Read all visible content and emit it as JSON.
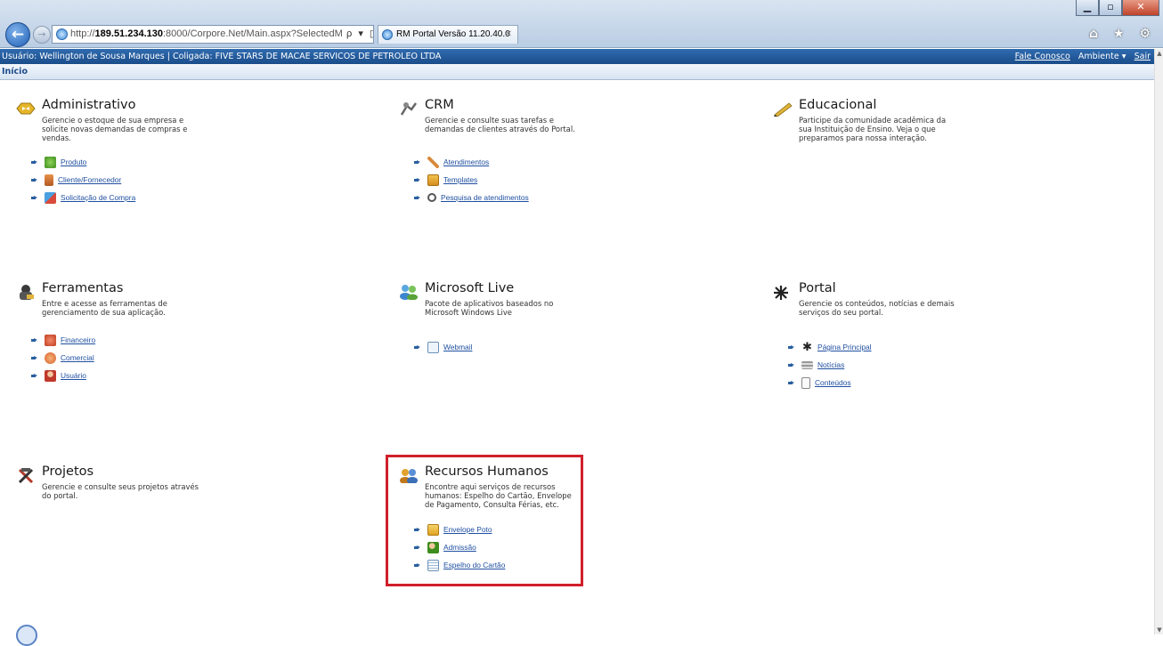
{
  "browser": {
    "url_prefix": "http://",
    "url_host": "189.51.234.130",
    "url_rest": ":8000/Corpore.Net/Main.aspx?SelectedM",
    "address_controls": "ρ ▾ ▯ ↻ ✕",
    "tab_title": "RM Portal Versão 11.20.40.0",
    "tab_close": "✕",
    "window_buttons": {
      "minimize": "▁",
      "restore": "▫",
      "close": "✕"
    },
    "right_icons": "⌂ ★ ⚙"
  },
  "header": {
    "user_info": "Usuário: Wellington de Sousa Marques  |  Coligada: FIVE STARS DE MACAE SERVICOS DE PETROLEO LTDA",
    "contact_link": "Fale Conosco",
    "ambiente_label": "Ambiente ▾",
    "exit_link": "Sair"
  },
  "breadcrumb": "Início",
  "modules": {
    "administrativo": {
      "title": "Administrativo",
      "description": "Gerencie o estoque de sua empresa e solicite novas demandas de compras e vendas.",
      "links": [
        "Produto",
        "Cliente/Fornecedor",
        "Solicitação de Compra"
      ]
    },
    "crm": {
      "title": "CRM",
      "description": "Gerencie e consulte suas tarefas e demandas de clientes através do Portal.",
      "links": [
        "Atendimentos",
        "Templates",
        "Pesquisa de atendimentos"
      ]
    },
    "educacional": {
      "title": "Educacional",
      "description": "Participe da comunidade acadêmica da sua Instituição de Ensino. Veja o que preparamos para nossa interação."
    },
    "ferramentas": {
      "title": "Ferramentas",
      "description": "Entre e acesse as ferramentas de gerenciamento de sua aplicação.",
      "links": [
        "Financeiro",
        "Comercial",
        "Usuário"
      ]
    },
    "microsoft_live": {
      "title": "Microsoft Live",
      "description": "Pacote de aplicativos baseados no Microsoft Windows Live",
      "links": [
        "Webmail"
      ]
    },
    "portal": {
      "title": "Portal",
      "description": "Gerencie os conteúdos, notícias e demais serviços do seu portal.",
      "links": [
        "Página Principal",
        "Notícias",
        "Conteúdos"
      ]
    },
    "projetos": {
      "title": "Projetos",
      "description": "Gerencie e consulte seus projetos através do portal."
    },
    "recursos_humanos": {
      "title": "Recursos Humanos",
      "description": "Encontre aqui serviços de recursos humanos: Espelho do Cartão, Envelope de Pagamento, Consulta Férias, etc.",
      "links": [
        "Envelope Poto",
        "Admissão",
        "Espelho do Cartão"
      ]
    }
  },
  "colors": {
    "header_blue": "#1b4d8a",
    "link_blue": "#1f4fa0",
    "highlight_red": "#d0202a"
  }
}
